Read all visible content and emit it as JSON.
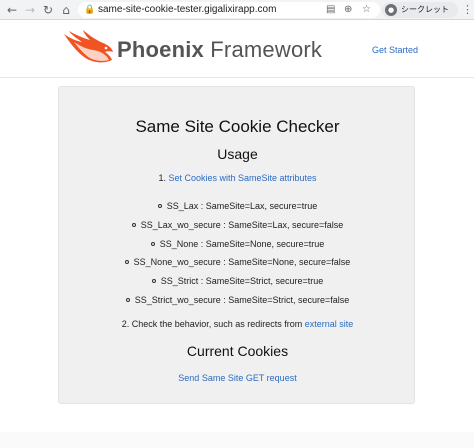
{
  "browser": {
    "back_icon": "arrow-left-icon",
    "forward_icon": "arrow-right-icon",
    "reload_icon": "reload-icon",
    "home_icon": "home-icon",
    "url": "same-site-cookie-tester.gigalixirapp.com",
    "profile_label": "シークレット"
  },
  "header": {
    "brand_bold": "Phoenix",
    "brand_rest": " Framework",
    "nav_link": "Get Started",
    "accent": "#f05423"
  },
  "main": {
    "title": "Same Site Cookie Checker",
    "usage_heading": "Usage",
    "step1_prefix": "1. ",
    "step1_link": "Set Cookies with SameSite attributes",
    "cookies": [
      "SS_Lax : SameSite=Lax, secure=true",
      "SS_Lax_wo_secure : SameSite=Lax, secure=false",
      "SS_None : SameSite=None, secure=true",
      "SS_None_wo_secure : SameSite=None, secure=false",
      "SS_Strict : SameSite=Strict, secure=true",
      "SS_Strict_wo_secure : SameSite=Strict, secure=false"
    ],
    "step2_text": "2. Check the behavior, such as redirects from ",
    "step2_link": "external site",
    "current_heading": "Current Cookies",
    "send_link": "Send Same Site GET request",
    "link_color": "#2b6cc4"
  }
}
